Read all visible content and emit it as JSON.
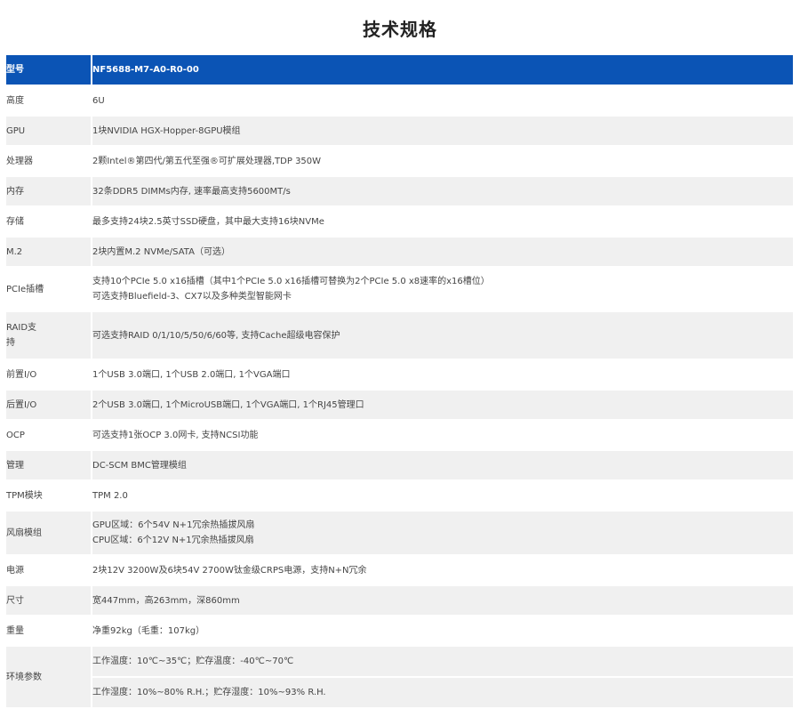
{
  "page_title": "技术规格",
  "header": {
    "label": "型号",
    "value": "NF5688-M7-A0-R0-00"
  },
  "rows": [
    {
      "label": "高度",
      "lines": [
        "6U"
      ]
    },
    {
      "label": "GPU",
      "lines": [
        "1块NVIDIA HGX-Hopper-8GPU模组"
      ]
    },
    {
      "label": "处理器",
      "lines": [
        "2颗Intel®第四代/第五代至强®可扩展处理器,TDP 350W"
      ]
    },
    {
      "label": "内存",
      "lines": [
        "32条DDR5 DIMMs内存, 速率最高支持5600MT/s"
      ]
    },
    {
      "label": "存储",
      "lines": [
        "最多支持24块2.5英寸SSD硬盘，其中最大支持16块NVMe"
      ]
    },
    {
      "label": "M.2",
      "lines": [
        "2块内置M.2 NVMe/SATA（可选）"
      ]
    },
    {
      "label": "PCIe插槽",
      "lines": [
        "支持10个PCIe 5.0 x16插槽（其中1个PCIe 5.0 x16插槽可替换为2个PCIe 5.0 x8速率的x16槽位）",
        "可选支持Bluefield-3、CX7以及多种类型智能网卡"
      ]
    },
    {
      "label": "RAID支持",
      "label_lines": [
        "RAID支",
        "持"
      ],
      "lines": [
        "可选支持RAID 0/1/10/5/50/6/60等, 支持Cache超级电容保护"
      ]
    },
    {
      "label": "前置I/O",
      "lines": [
        "1个USB 3.0端口, 1个USB 2.0端口, 1个VGA端口"
      ]
    },
    {
      "label": "后置I/O",
      "lines": [
        "2个USB 3.0端口, 1个MicroUSB端口, 1个VGA端口, 1个RJ45管理口"
      ]
    },
    {
      "label": "OCP",
      "lines": [
        "可选支持1张OCP 3.0网卡, 支持NCSI功能"
      ]
    },
    {
      "label": "管理",
      "lines": [
        "DC-SCM BMC管理模组"
      ]
    },
    {
      "label": "TPM模块",
      "lines": [
        "TPM 2.0"
      ]
    },
    {
      "label": "风扇模组",
      "lines": [
        "GPU区域：6个54V N+1冗余热插拔风扇",
        "CPU区域：6个12V N+1冗余热插拔风扇"
      ]
    },
    {
      "label": "电源",
      "lines": [
        "2块12V 3200W及6块54V 2700W钛金级CRPS电源，支持N+N冗余"
      ]
    },
    {
      "label": "尺寸",
      "lines": [
        "宽447mm，高263mm，深860mm"
      ]
    },
    {
      "label": "重量",
      "lines": [
        "净重92kg（毛重：107kg）"
      ]
    },
    {
      "label": "环境参数",
      "sub_rows": [
        "工作温度：10℃~35℃；贮存温度：-40℃~70℃",
        "工作湿度：10%~80% R.H.；贮存湿度：10%~93% R.H."
      ]
    }
  ],
  "colors": {
    "header_bg": "#0b54b5",
    "stripe_bg": "#f0f0f0",
    "text": "#444444"
  }
}
